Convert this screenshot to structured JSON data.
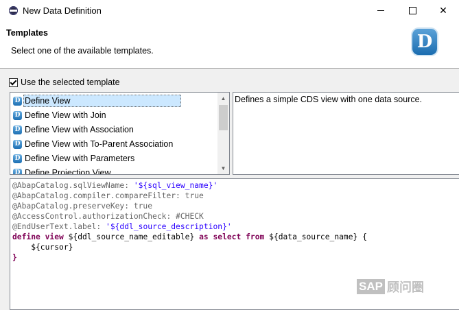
{
  "window": {
    "title": "New Data Definition",
    "icon": "eclipse-icon"
  },
  "banner": {
    "title": "Templates",
    "description": "Select one of the available templates.",
    "logo_letter": "D"
  },
  "use_template": {
    "label": "Use the selected template",
    "checked": true
  },
  "templates": {
    "items": [
      {
        "label": "Define View",
        "selected": true
      },
      {
        "label": "Define View with Join"
      },
      {
        "label": "Define View with Association"
      },
      {
        "label": "Define View with To-Parent Association"
      },
      {
        "label": "Define View with Parameters"
      },
      {
        "label": "Define Projection View"
      }
    ],
    "icon_letter": "D"
  },
  "template_description": "Defines a simple CDS view with one data source.",
  "code": {
    "lines": [
      {
        "annotation": "@AbapCatalog.sqlViewName: ",
        "string": "'${sql_view_name}'"
      },
      {
        "annotation": "@AbapCatalog.compiler.compareFilter: true"
      },
      {
        "annotation": "@AbapCatalog.preserveKey: true"
      },
      {
        "annotation": "@AccessControl.authorizationCheck: #CHECK"
      },
      {
        "annotation": "@EndUserText.label: ",
        "string": "'${ddl_source_description}'"
      }
    ],
    "define_kw": "define view",
    "define_name": " ${ddl_source_name_editable} ",
    "as_select_from_kw": "as select from",
    "data_source": " ${data_source_name} {",
    "cursor_line": "    ${cursor}",
    "closing_brace": "}"
  },
  "watermark": {
    "sap": "SAP",
    "text": "顾问圈"
  },
  "colors": {
    "selection": "#cce8ff",
    "annotation": "#646464",
    "string": "#2a00ff",
    "keyword": "#7f0055"
  }
}
